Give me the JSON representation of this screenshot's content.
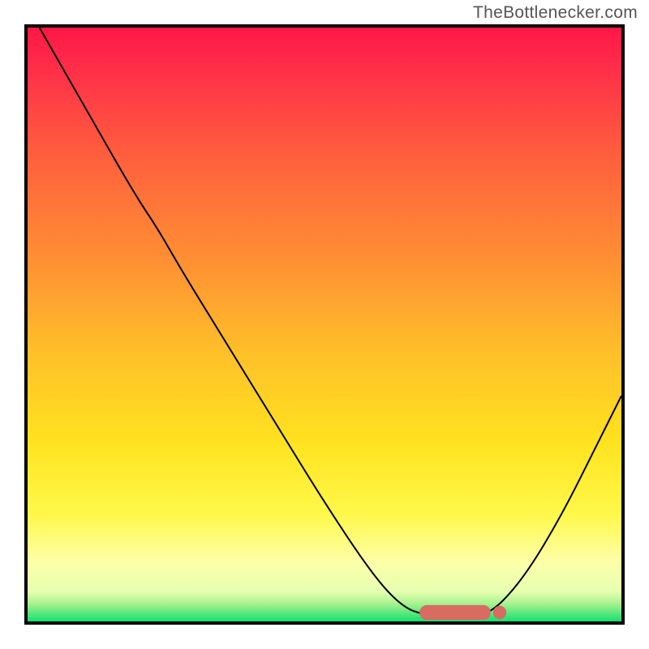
{
  "watermark": "TheBottlenecker.com",
  "chart_data": {
    "type": "line",
    "title": "",
    "xlabel": "",
    "ylabel": "",
    "xlim": [
      0,
      100
    ],
    "ylim": [
      0,
      100
    ],
    "background_gradient": [
      {
        "stop": 0.0,
        "color": "#ff1744"
      },
      {
        "stop": 0.06,
        "color": "#ff2b4a"
      },
      {
        "stop": 0.2,
        "color": "#ff5a3e"
      },
      {
        "stop": 0.4,
        "color": "#ff9233"
      },
      {
        "stop": 0.55,
        "color": "#ffc029"
      },
      {
        "stop": 0.7,
        "color": "#ffe31f"
      },
      {
        "stop": 0.82,
        "color": "#fff84a"
      },
      {
        "stop": 0.9,
        "color": "#fdffa8"
      },
      {
        "stop": 0.95,
        "color": "#e6ffb0"
      },
      {
        "stop": 0.97,
        "color": "#a8f28f"
      },
      {
        "stop": 1.0,
        "color": "#14e06e"
      }
    ],
    "series": [
      {
        "name": "bottleneck-curve",
        "color": "#000000",
        "width": 2,
        "data": [
          {
            "x": 2,
            "y": 100
          },
          {
            "x": 10,
            "y": 86
          },
          {
            "x": 18,
            "y": 72
          },
          {
            "x": 22,
            "y": 66
          },
          {
            "x": 26,
            "y": 59
          },
          {
            "x": 34,
            "y": 46
          },
          {
            "x": 42,
            "y": 33
          },
          {
            "x": 50,
            "y": 20
          },
          {
            "x": 58,
            "y": 8
          },
          {
            "x": 63,
            "y": 2.5
          },
          {
            "x": 67,
            "y": 1.0
          },
          {
            "x": 72,
            "y": 0.8
          },
          {
            "x": 76,
            "y": 1.0
          },
          {
            "x": 79,
            "y": 2.2
          },
          {
            "x": 84,
            "y": 8
          },
          {
            "x": 90,
            "y": 18
          },
          {
            "x": 96,
            "y": 30
          },
          {
            "x": 100,
            "y": 38
          }
        ]
      }
    ],
    "marker": {
      "color": "#d96b63",
      "x_start": 66,
      "x_end": 78,
      "y": 1.5,
      "height": 2.5
    }
  }
}
